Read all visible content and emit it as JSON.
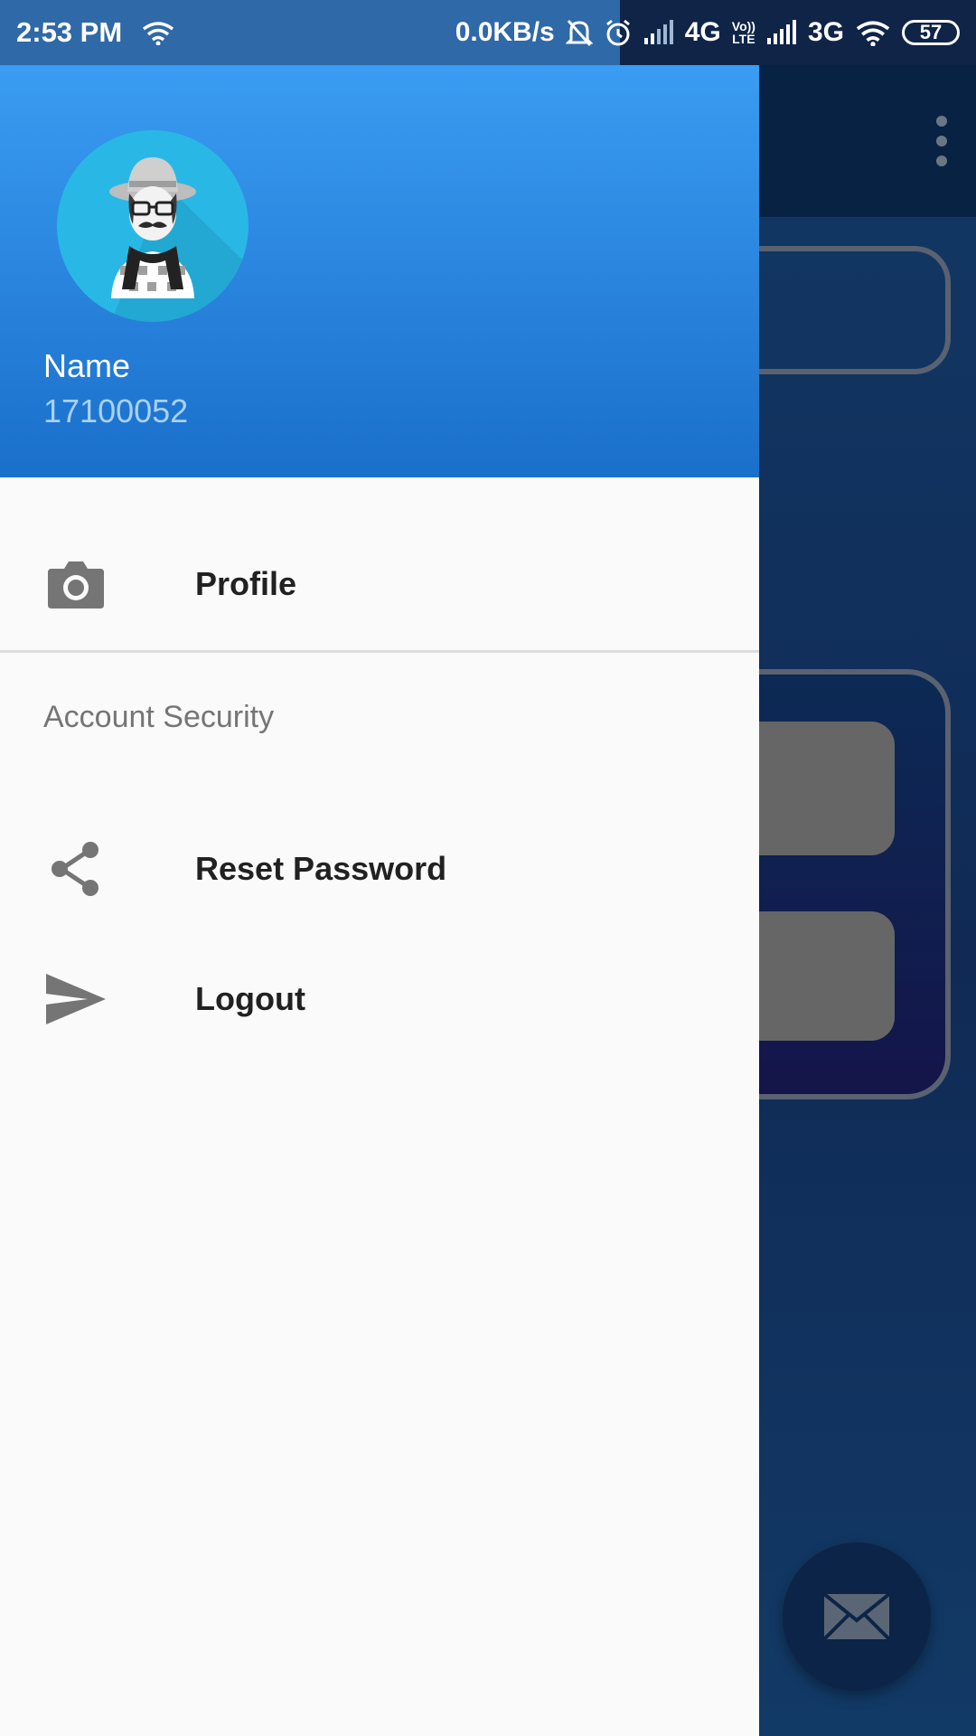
{
  "status_bar": {
    "time": "2:53 PM",
    "net_speed": "0.0KB/s",
    "network1": "4G",
    "volte_line1": "Vo))",
    "volte_line2": "LTE",
    "network2": "3G",
    "battery": "57",
    "icons": [
      "wifi-icon",
      "mute-bell-icon",
      "alarm-icon",
      "signal-icon",
      "signal-icon",
      "wifi-icon",
      "battery-icon"
    ]
  },
  "drawer": {
    "header": {
      "name": "Name",
      "id": "17100052",
      "avatar_icon": "avatar-icon"
    },
    "items": [
      {
        "label": "Profile",
        "icon": "camera-icon"
      }
    ],
    "section": {
      "title": "Account Security",
      "items": [
        {
          "label": "Reset Password",
          "icon": "share-icon"
        },
        {
          "label": "Logout",
          "icon": "send-icon"
        }
      ]
    }
  },
  "background_app": {
    "overflow_icon": "more-vert-icon",
    "fab_icon": "mail-icon"
  },
  "colors": {
    "drawer_header_top": "#3a9cf2",
    "drawer_header_bottom": "#1a6fca",
    "drawer_bg": "#fafafa",
    "item_text": "#212121",
    "section_text": "#757575",
    "icon_gray": "#757575"
  }
}
